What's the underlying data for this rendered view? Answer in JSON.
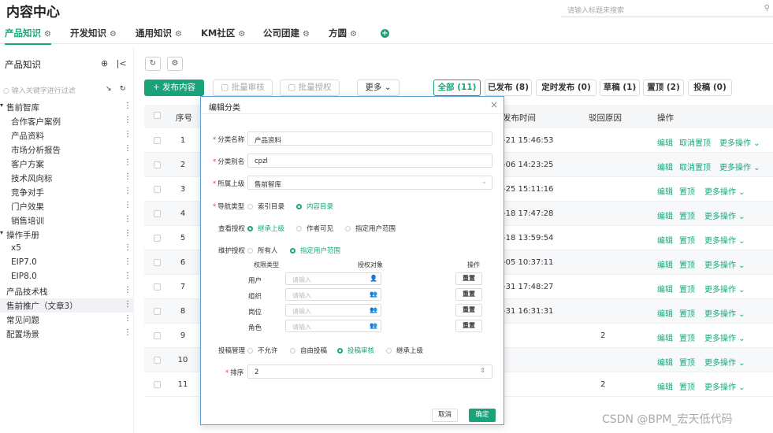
{
  "header": {
    "title": "内容中心",
    "search_placeholder": "请输入标题来搜索"
  },
  "tabs": [
    {
      "label": "产品知识",
      "active": true
    },
    {
      "label": "开发知识"
    },
    {
      "label": "通用知识"
    },
    {
      "label": "KM社区"
    },
    {
      "label": "公司团建"
    },
    {
      "label": "方圆"
    }
  ],
  "sidebar": {
    "title": "产品知识",
    "search_placeholder": "输入关键字进行过滤",
    "items": [
      {
        "label": "售前智库",
        "level": 0,
        "expanded": true
      },
      {
        "label": "合作客户案例",
        "level": 1
      },
      {
        "label": "产品资料",
        "level": 1
      },
      {
        "label": "市场分析报告",
        "level": 1
      },
      {
        "label": "客户方案",
        "level": 1
      },
      {
        "label": "技术风向标",
        "level": 1
      },
      {
        "label": "竞争对手",
        "level": 1
      },
      {
        "label": "门户效果",
        "level": 1
      },
      {
        "label": "销售培训",
        "level": 1
      },
      {
        "label": "操作手册",
        "level": 0,
        "expanded": true
      },
      {
        "label": "x5",
        "level": 1
      },
      {
        "label": "EIP7.0",
        "level": 1
      },
      {
        "label": "EIP8.0",
        "level": 1
      },
      {
        "label": "产品技术栈",
        "level": 0
      },
      {
        "label": "售前推广（文章3）",
        "level": 0,
        "selected": true
      },
      {
        "label": "常见问题",
        "level": 0
      },
      {
        "label": "配置场景",
        "level": 0
      }
    ]
  },
  "toolbar": {
    "publish": "+ 发布内容",
    "batch_review": "批量审核",
    "batch_auth": "批量授权",
    "more": "更多"
  },
  "filters": [
    {
      "label": "全部 (11)",
      "active": true
    },
    {
      "label": "已发布 (8)"
    },
    {
      "label": "定时发布 (0)"
    },
    {
      "label": "草稿 (1)"
    },
    {
      "label": "置顶 (2)"
    },
    {
      "label": "投稿 (0)"
    }
  ],
  "table": {
    "headers": {
      "index": "序号",
      "time": "发布时间",
      "reason": "驳回原因",
      "ops": "操作"
    },
    "rows": [
      {
        "idx": "1",
        "time": "-21 15:46:53",
        "reason": "",
        "pin": "取消置顶",
        "more": "更多操作"
      },
      {
        "idx": "2",
        "time": "-06 14:23:25",
        "reason": "",
        "pin": "取消置顶",
        "more": "更多操作"
      },
      {
        "idx": "3",
        "time": "-25 15:11:16",
        "reason": "",
        "pin": "置顶",
        "more": "更多操作"
      },
      {
        "idx": "4",
        "time": "-18 17:47:28",
        "reason": "",
        "pin": "置顶",
        "more": "更多操作"
      },
      {
        "idx": "5",
        "time": "-18 13:59:54",
        "reason": "",
        "pin": "置顶",
        "more": "更多操作"
      },
      {
        "idx": "6",
        "time": "-05 10:37:11",
        "reason": "",
        "pin": "置顶",
        "more": "更多操作"
      },
      {
        "idx": "7",
        "time": "-31 17:48:27",
        "reason": "",
        "pin": "置顶",
        "more": "更多操作"
      },
      {
        "idx": "8",
        "time": "-31 16:31:31",
        "reason": "",
        "pin": "置顶",
        "more": "更多操作"
      },
      {
        "idx": "9",
        "time": "",
        "reason": "2",
        "pin": "置顶",
        "more": "更多操作"
      },
      {
        "idx": "10",
        "time": "",
        "reason": "",
        "pin": "置顶",
        "more": "更多操作"
      },
      {
        "idx": "11",
        "time": "",
        "reason": "2",
        "pin": "置顶",
        "more": "更多操作"
      }
    ],
    "edit_label": "编辑"
  },
  "modal": {
    "title": "编辑分类",
    "name_label": "分类名称",
    "name_value": "产品资料",
    "alias_label": "分类别名",
    "alias_value": "cpzl",
    "parent_label": "所属上级",
    "parent_value": "售前智库",
    "nav_label": "导航类型",
    "nav_options": [
      "索引目录",
      "内容目录"
    ],
    "view_label": "查看授权",
    "view_options": [
      "继承上级",
      "作者可见",
      "指定用户范围"
    ],
    "maint_label": "维护授权",
    "maint_options": [
      "所有人",
      "指定用户范围"
    ],
    "perm_headers": {
      "type": "权限类型",
      "target": "授权对象",
      "op": "操作"
    },
    "perm_rows": [
      {
        "label": "用户",
        "placeholder": "请输入",
        "btn": "重置"
      },
      {
        "label": "组织",
        "placeholder": "请输入",
        "btn": "重置"
      },
      {
        "label": "岗位",
        "placeholder": "请输入",
        "btn": "重置"
      },
      {
        "label": "角色",
        "placeholder": "请输入",
        "btn": "重置"
      }
    ],
    "contrib_label": "投稿管理",
    "contrib_options": [
      "不允许",
      "自由投稿",
      "投稿审核",
      "继承上级"
    ],
    "sort_label": "排序",
    "sort_value": "2",
    "cancel": "取消",
    "confirm": "确定"
  },
  "watermark": "CSDN @BPM_宏天低代码"
}
